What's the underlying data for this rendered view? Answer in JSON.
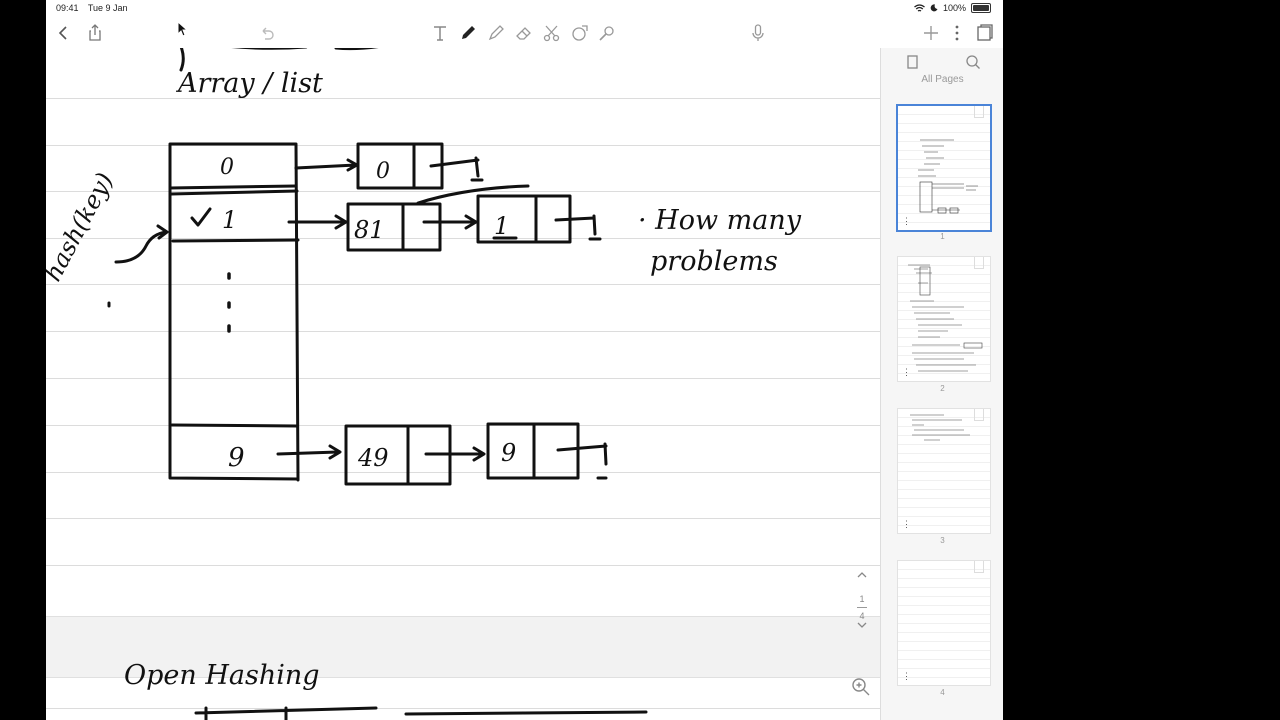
{
  "status": {
    "time": "09:41",
    "date": "Tue 9 Jan",
    "battery": "100%"
  },
  "notes": {
    "heading_top": "Array / list",
    "label_hash": "hash(key)",
    "index_0": "0",
    "index_1": "1",
    "index_9": "9",
    "node_0": "0",
    "node_81": "81",
    "node_1": "1",
    "node_49": "49",
    "node_9": "9",
    "note_how": "· How many",
    "note_problems": "problems",
    "heading_bottom": "Open Hashing"
  },
  "pager": {
    "current": "1",
    "total": "4"
  },
  "sidebar": {
    "title": "All Pages",
    "pages": [
      "1",
      "2",
      "3",
      "4"
    ]
  },
  "icons": {
    "back": "chevron-left-icon",
    "share": "share-icon",
    "undo": "undo-icon",
    "text": "text-tool-icon",
    "pen": "pen-icon",
    "highlighter": "highlighter-icon",
    "eraser": "eraser-icon",
    "scissors": "lasso-scissors-icon",
    "shapes": "shapes-icon",
    "laser": "laser-pointer-icon",
    "mic": "microphone-icon",
    "add": "add-page-icon",
    "more": "more-icon",
    "pages": "pages-icon",
    "zoom": "zoom-icon"
  }
}
